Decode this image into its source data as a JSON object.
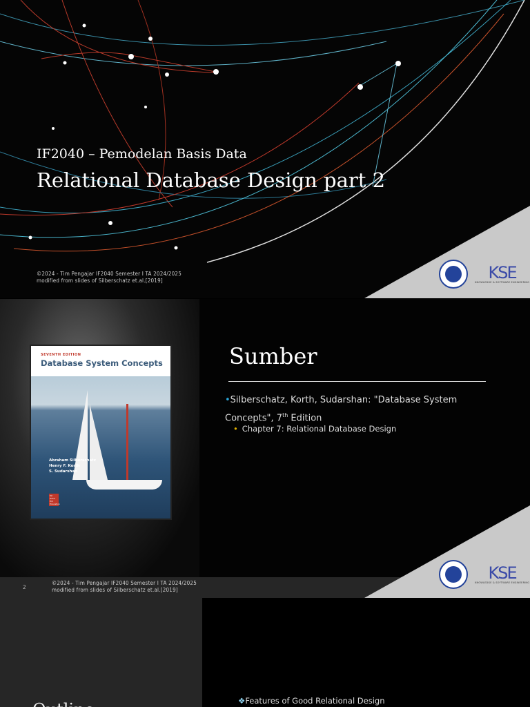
{
  "slide1": {
    "course": "IF2040 – Pemodelan Basis Data",
    "title": "Relational Database Design part 2",
    "copyright": "©2024 - Tim Pengajar IF2040 Semester I TA 2024/2025",
    "modified": "modified from slides of Silberschatz et.al.[2019]",
    "kse_logo": "KSE",
    "kse_sub": "KNOWLEDGE & SOFTWARE ENGINEERING"
  },
  "slide2": {
    "title": "Sumber",
    "bullet1": "Silberschatz, Korth, Sudarshan: \"Database System Concepts\", 7",
    "bullet1_sup": "th",
    "bullet1_end": " Edition",
    "sub1": "Chapter 7: Relational Database Design",
    "book": {
      "edition": "SEVENTH EDITION",
      "title": "Database System Concepts",
      "authors": [
        "Abraham Silberschatz",
        "Henry F. Korth",
        "S. Sudarshan"
      ],
      "publisher": "Mc Graw Hill Education"
    },
    "page_number": "2",
    "copyright": "©2024 - Tim Pengajar IF2040 Semester I TA 2024/2025",
    "modified": "modified from slides of Silberschatz et.al.[2019]",
    "kse_logo": "KSE",
    "kse_sub": "KNOWLEDGE & SOFTWARE ENGINEERING"
  },
  "slide3": {
    "title": "Outline",
    "item1": "Features of Good Relational Design"
  }
}
